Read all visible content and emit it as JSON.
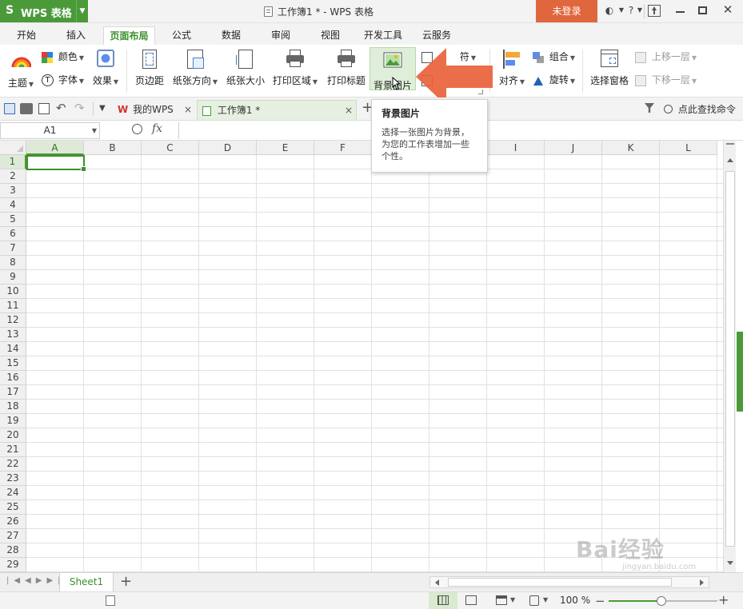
{
  "app": {
    "logo_icon": "wps-s-logo",
    "name": "WPS 表格",
    "window_title": "工作簿1 * - WPS 表格",
    "login_label": "未登录",
    "accent_color": "#4b9a3a",
    "login_color": "#e0663e"
  },
  "menu": {
    "tabs": [
      "开始",
      "插入",
      "页面布局",
      "公式",
      "数据",
      "审阅",
      "视图",
      "开发工具",
      "云服务"
    ],
    "active": "页面布局"
  },
  "ribbon": {
    "theme": "主题",
    "color": "颜色",
    "font": "字体",
    "effect": "效果",
    "margin": "页边距",
    "orientation": "纸张方向",
    "size": "纸张大小",
    "print_area": "打印区域",
    "print_titles": "打印标题",
    "background": "背景图片",
    "partial": "符",
    "align": "对齐",
    "group": "组合",
    "rotate": "旋转",
    "selection_pane": "选择窗格",
    "bring_forward": "上移一层",
    "send_backward": "下移一层"
  },
  "filebar": {
    "tab1": "我的WPS",
    "tab2": "工作簿1 *",
    "search": "点此查找命令"
  },
  "formula": {
    "namebox": "A1",
    "fx": "fx"
  },
  "grid": {
    "columns": [
      "A",
      "B",
      "C",
      "D",
      "E",
      "F",
      "G",
      "H",
      "I",
      "J",
      "K",
      "L"
    ],
    "rows": [
      "1",
      "2",
      "3",
      "4",
      "5",
      "6",
      "7",
      "8",
      "9",
      "10",
      "11",
      "12",
      "13",
      "14",
      "15",
      "16",
      "17",
      "18",
      "19",
      "20",
      "21",
      "22",
      "23",
      "24",
      "25",
      "26",
      "27",
      "28",
      "29"
    ],
    "selected_cell": "A1"
  },
  "tooltip": {
    "title": "背景图片",
    "body": "选择一张图片为背景，为您的工作表增加一些个性。"
  },
  "sheets": {
    "active": "Sheet1",
    "add": "+"
  },
  "status": {
    "zoom": "100 %"
  },
  "watermark": {
    "line1": "Bai经验",
    "line2": "jingyan.baidu.com"
  }
}
